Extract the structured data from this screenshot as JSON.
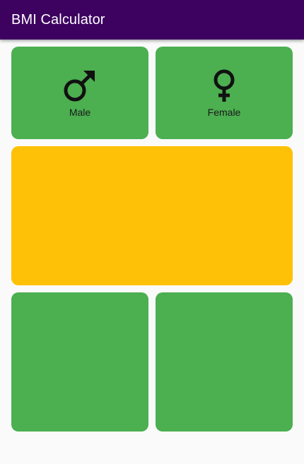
{
  "app": {
    "title": "BMI Calculator"
  },
  "gender": {
    "male": {
      "label": "Male",
      "icon": "male-symbol-icon"
    },
    "female": {
      "label": "Female",
      "icon": "female-symbol-icon"
    }
  },
  "colors": {
    "appbar": "#3d0160",
    "card_green": "#4caf50",
    "card_amber": "#ffc107",
    "background": "#fafafa"
  }
}
